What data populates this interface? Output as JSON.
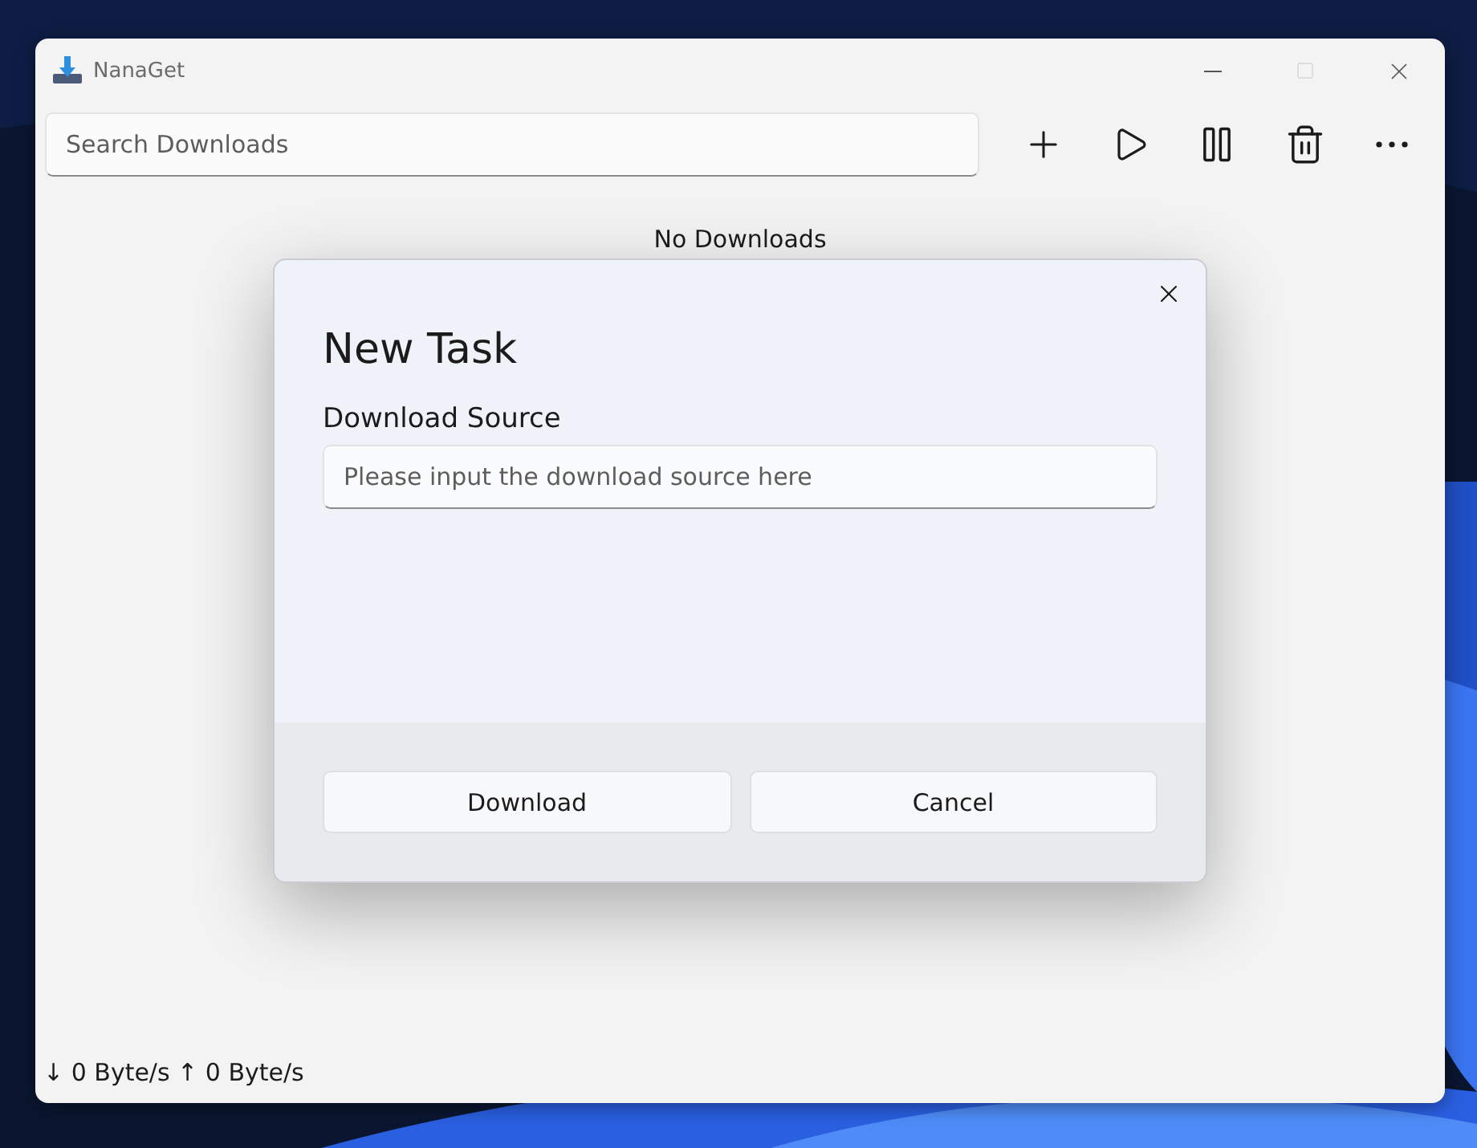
{
  "window": {
    "title": "NanaGet",
    "controls": [
      {
        "kind": "minimize",
        "disabled": false
      },
      {
        "kind": "maximize",
        "disabled": true
      },
      {
        "kind": "close",
        "disabled": false
      }
    ]
  },
  "toolbar": {
    "search": {
      "placeholder": "Search Downloads"
    },
    "buttons": [
      {
        "kind": "add"
      },
      {
        "kind": "play"
      },
      {
        "kind": "pause"
      },
      {
        "kind": "delete"
      },
      {
        "kind": "more"
      }
    ]
  },
  "empty_message": "No Downloads",
  "dialog": {
    "title": "New Task",
    "field_label": "Download Source",
    "field": {
      "placeholder": "Please input the download source here"
    },
    "buttons": [
      "Download",
      "Cancel"
    ]
  },
  "status_bar": "↓ 0 Byte/s ↑ 0 Byte/s"
}
